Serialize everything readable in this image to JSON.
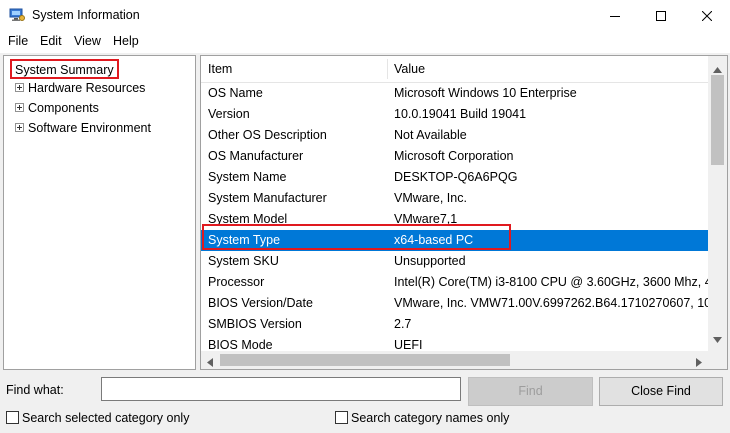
{
  "window": {
    "title": "System Information",
    "controls": {
      "minimize": "minimize-icon",
      "maximize": "maximize-icon",
      "close": "close-icon"
    }
  },
  "menu": {
    "items": [
      "File",
      "Edit",
      "View",
      "Help"
    ]
  },
  "tree": {
    "root": "System Summary",
    "children": [
      "Hardware Resources",
      "Components",
      "Software Environment"
    ]
  },
  "list": {
    "columns": [
      "Item",
      "Value"
    ],
    "rows": [
      {
        "item": "OS Name",
        "value": "Microsoft Windows 10 Enterprise"
      },
      {
        "item": "Version",
        "value": "10.0.19041 Build 19041"
      },
      {
        "item": "Other OS Description",
        "value": "Not Available"
      },
      {
        "item": "OS Manufacturer",
        "value": "Microsoft Corporation"
      },
      {
        "item": "System Name",
        "value": "DESKTOP-Q6A6PQG"
      },
      {
        "item": "System Manufacturer",
        "value": "VMware, Inc."
      },
      {
        "item": "System Model",
        "value": "VMware7,1"
      },
      {
        "item": "System Type",
        "value": "x64-based PC"
      },
      {
        "item": "System SKU",
        "value": "Unsupported"
      },
      {
        "item": "Processor",
        "value": "Intel(R) Core(TM) i3-8100 CPU @ 3.60GHz, 3600 Mhz, 4"
      },
      {
        "item": "BIOS Version/Date",
        "value": "VMware, Inc. VMW71.00V.6997262.B64.1710270607, 10"
      },
      {
        "item": "SMBIOS Version",
        "value": "2.7"
      },
      {
        "item": "BIOS Mode",
        "value": "UEFI"
      }
    ],
    "selected_row": 7
  },
  "find": {
    "label": "Find what:",
    "value": "",
    "find_button": "Find",
    "close_find_button": "Close Find",
    "search_selected_label": "Search selected category only",
    "search_names_label": "Search category names only"
  },
  "colors": {
    "selection": "#0078d7",
    "annotation": "#e0191f"
  }
}
